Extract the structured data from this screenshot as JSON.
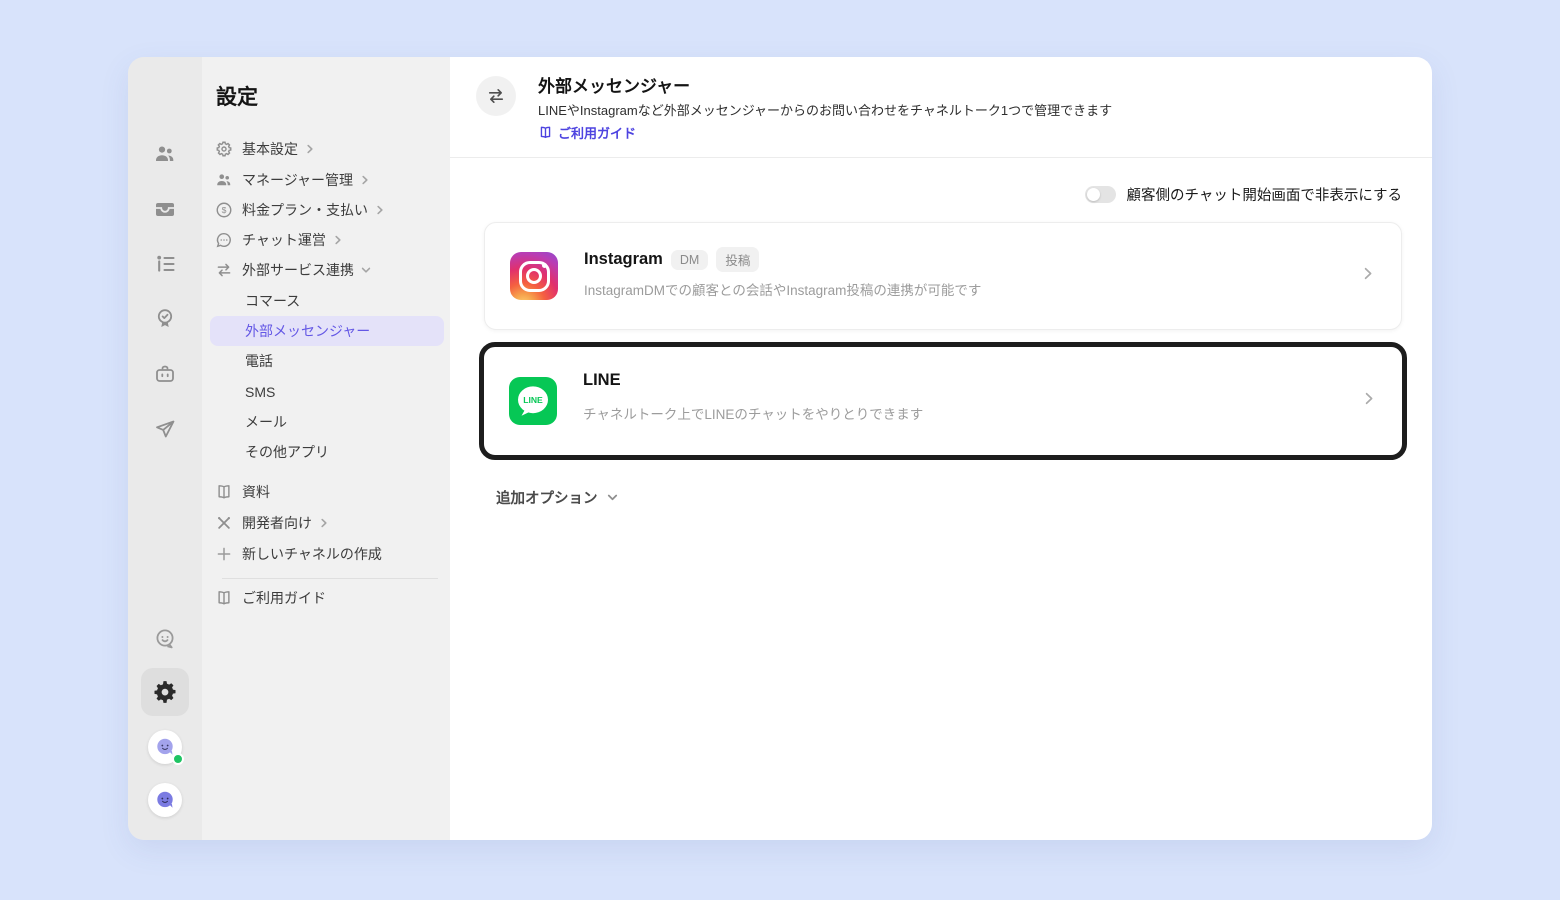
{
  "sidebar": {
    "title": "設定",
    "items": [
      {
        "label": "基本設定",
        "icon": "gear",
        "chevron": "right"
      },
      {
        "label": "マネージャー管理",
        "icon": "people",
        "chevron": "right"
      },
      {
        "label": "料金プラン・支払い",
        "icon": "dollar-circle",
        "chevron": "right"
      },
      {
        "label": "チャット運営",
        "icon": "chat-dots",
        "chevron": "right"
      },
      {
        "label": "外部サービス連携",
        "icon": "swap-arrows",
        "chevron": "down"
      }
    ],
    "sub_items": [
      {
        "label": "コマース",
        "selected": false
      },
      {
        "label": "外部メッセンジャー",
        "selected": true
      },
      {
        "label": "電話",
        "selected": false
      },
      {
        "label": "SMS",
        "selected": false
      },
      {
        "label": "メール",
        "selected": false
      },
      {
        "label": "その他アプリ",
        "selected": false
      }
    ],
    "tools": [
      {
        "label": "資料",
        "icon": "book"
      },
      {
        "label": "開発者向け",
        "icon": "cross-tools",
        "chevron": "right"
      },
      {
        "label": "新しいチャネルの作成",
        "icon": "plus"
      }
    ],
    "guide": {
      "label": "ご利用ガイド",
      "icon": "book"
    }
  },
  "rail": {
    "icons": [
      "people",
      "inbox-tray",
      "contact-list",
      "badge-check",
      "bot",
      "paper-plane",
      "smiley-bubble",
      "gear"
    ],
    "selected_icon": "gear",
    "avatars": [
      {
        "name": "workspace-avatar",
        "online": true
      },
      {
        "name": "workspace-avatar",
        "online": false
      }
    ]
  },
  "main": {
    "header": {
      "icon": "swap-arrows",
      "title": "外部メッセンジャー",
      "description": "LINEやInstagramなど外部メッセンジャーからのお問い合わせをチャネルトーク1つで管理できます",
      "guide_link": "ご利用ガイド"
    },
    "visibility_toggle": {
      "label": "顧客側のチャット開始画面で非表示にする",
      "state": "off"
    },
    "cards": [
      {
        "name": "Instagram",
        "icon": "instagram",
        "badges": [
          "DM",
          "投稿"
        ],
        "description": "InstagramDMでの顧客との会話やInstagram投稿の連携が可能です",
        "highlighted": false
      },
      {
        "name": "LINE",
        "icon": "line",
        "badges": [],
        "description": "チャネルトーク上でLINEのチャットをやりとりできます",
        "highlighted": true
      }
    ],
    "more_options_label": "追加オプション"
  },
  "colors": {
    "page_background": "#D8E3FB",
    "accent_indigo": "#4D43E0",
    "selected_item_bg": "#E4E2F9",
    "line_green": "#06C755",
    "highlight_border": "#1D1D1D",
    "toggle_off_track": "#E4E4E4",
    "online_green": "#1FC463"
  }
}
